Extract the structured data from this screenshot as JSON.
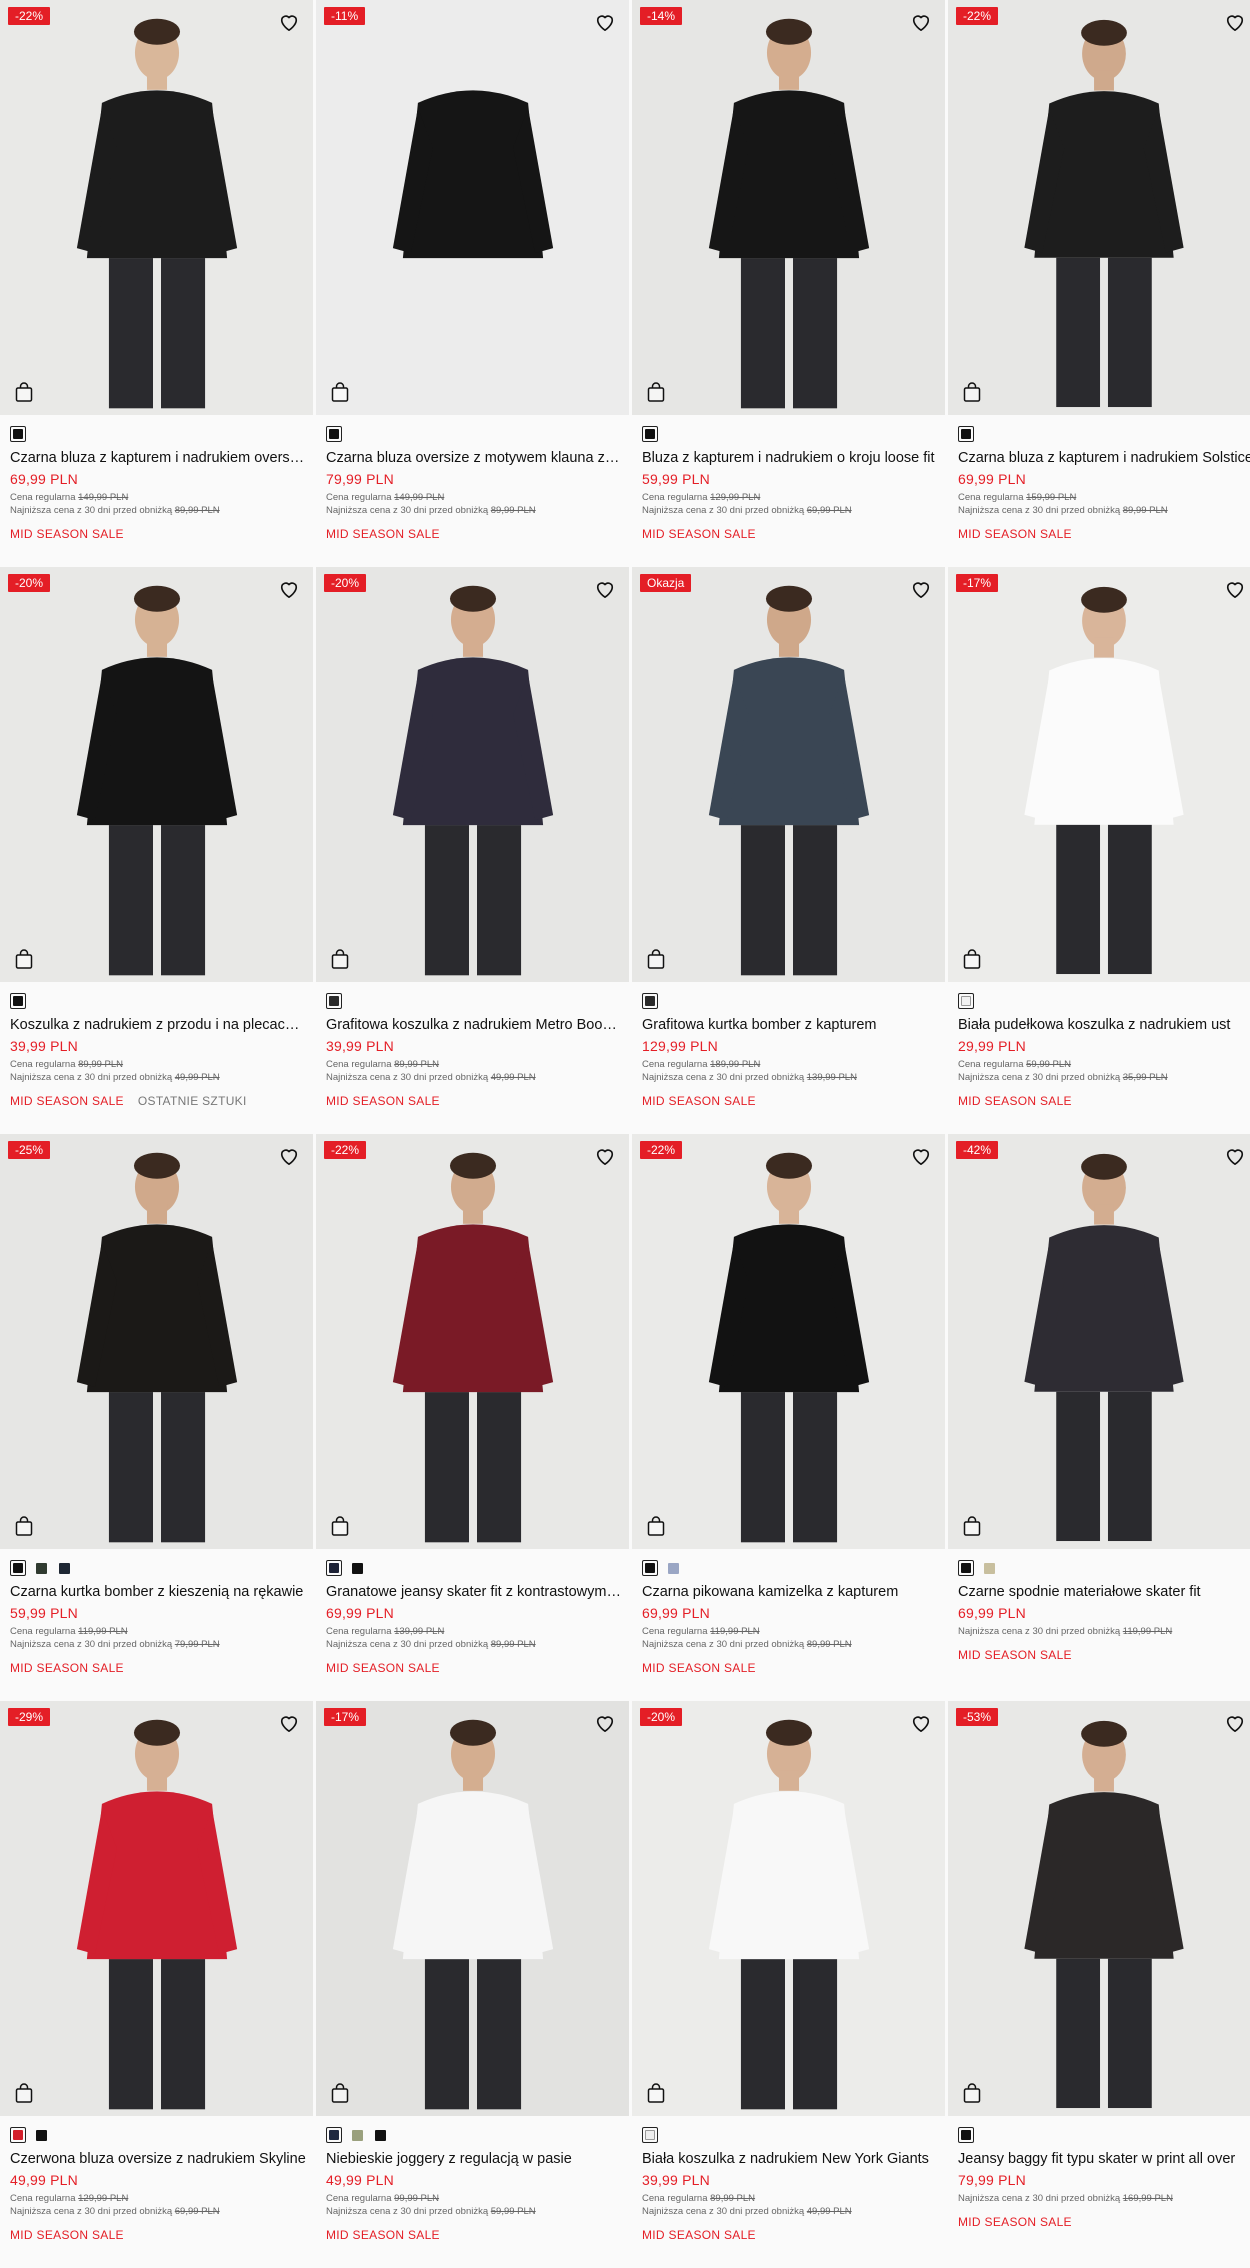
{
  "labels": {
    "regular": "Cena regularna",
    "lowest": "Najniższa cena z 30 dni przed obniżką",
    "sale": "MID SEASON SALE",
    "last": "OSTATNIE SZTUKI"
  },
  "products": [
    {
      "badge": "-22%",
      "name": "Czarna bluza z kapturem i nadrukiem oversize",
      "price": "69,99 PLN",
      "regular": "149,99 PLN",
      "lowest": "89,99 PLN",
      "swatches": [
        "#111111"
      ],
      "bg": "#e9e9e7",
      "cloth": "#1c1c1c",
      "skin": "#d9b79a",
      "tags": [
        "sale"
      ]
    },
    {
      "badge": "-11%",
      "name": "Czarna bluza oversize z motywem klauna z d…",
      "price": "79,99 PLN",
      "regular": "149,99 PLN",
      "lowest": "89,99 PLN",
      "swatches": [
        "#111111"
      ],
      "bg": "#ececec",
      "cloth": "#151515",
      "skin": "none",
      "tags": [
        "sale"
      ]
    },
    {
      "badge": "-14%",
      "name": "Bluza z kapturem i nadrukiem o kroju loose fit",
      "price": "59,99 PLN",
      "regular": "129,99 PLN",
      "lowest": "69,99 PLN",
      "swatches": [
        "#111111"
      ],
      "bg": "#e6e6e4",
      "cloth": "#161616",
      "skin": "#d4ad8f",
      "tags": [
        "sale"
      ]
    },
    {
      "badge": "-22%",
      "name": "Czarna bluza z kapturem i nadrukiem Solstice",
      "price": "69,99 PLN",
      "regular": "159,99 PLN",
      "lowest": "89,99 PLN",
      "swatches": [
        "#111111"
      ],
      "bg": "#e7e7e5",
      "cloth": "#1d1d1d",
      "skin": "#cfa98c",
      "tags": [
        "sale"
      ]
    },
    {
      "badge": "-20%",
      "name": "Koszulka z nadrukiem z przodu i na plecach …",
      "price": "39,99 PLN",
      "regular": "89,99 PLN",
      "lowest": "49,99 PLN",
      "swatches": [
        "#111111"
      ],
      "bg": "#e8e8e6",
      "cloth": "#141414",
      "skin": "#d6b294",
      "tags": [
        "sale",
        "last"
      ]
    },
    {
      "badge": "-20%",
      "name": "Grafitowa koszulka z nadrukiem Metro Boo…",
      "price": "39,99 PLN",
      "regular": "89,99 PLN",
      "lowest": "49,99 PLN",
      "swatches": [
        "#2a2a2a"
      ],
      "bg": "#e6e6e4",
      "cloth": "#2f2c3c",
      "skin": "#d4ad90",
      "tags": [
        "sale"
      ]
    },
    {
      "badge": "Okazja",
      "name": "Grafitowa kurtka bomber z kapturem",
      "price": "129,99 PLN",
      "regular": "189,99 PLN",
      "lowest": "139,99 PLN",
      "swatches": [
        "#2b2b2b"
      ],
      "bg": "#e7e7e5",
      "cloth": "#3a4654",
      "skin": "#cfa88a",
      "tags": [
        "sale"
      ]
    },
    {
      "badge": "-17%",
      "name": "Biała pudełkowa koszulka z nadrukiem ust",
      "price": "29,99 PLN",
      "regular": "59,99 PLN",
      "lowest": "35,99 PLN",
      "swatches": [
        "#f2f2f2"
      ],
      "bg": "#ececea",
      "cloth": "#fbfbfb",
      "skin": "#d9b59a",
      "tags": [
        "sale"
      ]
    },
    {
      "badge": "-25%",
      "name": "Czarna kurtka bomber z kieszenią na rękawie",
      "price": "59,99 PLN",
      "regular": "119,99 PLN",
      "lowest": "79,99 PLN",
      "swatches": [
        "#111111",
        "#2f3a2f",
        "#1e2733"
      ],
      "bg": "#e6e6e4",
      "cloth": "#1b1917",
      "skin": "#d0a98b",
      "tags": [
        "sale"
      ]
    },
    {
      "badge": "-22%",
      "name": "Granatowe jeansy skater fit z kontrastowymi…",
      "price": "69,99 PLN",
      "regular": "139,99 PLN",
      "lowest": "89,99 PLN",
      "swatches": [
        "#1d2236",
        "#111111"
      ],
      "bg": "#e8e8e6",
      "cloth": "#7a1a26",
      "skin": "#d1ab8e",
      "tags": [
        "sale"
      ]
    },
    {
      "badge": "-22%",
      "name": "Czarna pikowana kamizelka z kapturem",
      "price": "69,99 PLN",
      "regular": "119,99 PLN",
      "lowest": "89,99 PLN",
      "swatches": [
        "#111111",
        "#9aa6c4"
      ],
      "bg": "#eaeae8",
      "cloth": "#121212",
      "skin": "#d8b498",
      "tags": [
        "sale"
      ]
    },
    {
      "badge": "-42%",
      "name": "Czarne spodnie materiałowe skater fit",
      "price": "69,99 PLN",
      "regular": "",
      "lowest": "119,99 PLN",
      "swatches": [
        "#111111",
        "#c8bf9e"
      ],
      "bg": "#e8e8e6",
      "cloth": "#2e2c33",
      "skin": "#d3ad90",
      "tags": [
        "sale"
      ]
    },
    {
      "badge": "-29%",
      "name": "Czerwona bluza oversize z nadrukiem Skyline",
      "price": "49,99 PLN",
      "regular": "129,99 PLN",
      "lowest": "69,99 PLN",
      "swatches": [
        "#d31f2b",
        "#111111"
      ],
      "bg": "#e7e7e5",
      "cloth": "#cf1f31",
      "skin": "#d6b094",
      "tags": [
        "sale"
      ]
    },
    {
      "badge": "-17%",
      "name": "Niebieskie joggery z regulacją w pasie",
      "price": "49,99 PLN",
      "regular": "99,99 PLN",
      "lowest": "59,99 PLN",
      "swatches": [
        "#1f2840",
        "#9aa07d",
        "#111111"
      ],
      "bg": "#e2e2e0",
      "cloth": "#f6f6f6",
      "skin": "#d4ae90",
      "tags": [
        "sale"
      ]
    },
    {
      "badge": "-20%",
      "name": "Biała koszulka z nadrukiem New York Giants",
      "price": "39,99 PLN",
      "regular": "89,99 PLN",
      "lowest": "49,99 PLN",
      "swatches": [
        "#eeeeee"
      ],
      "bg": "#ececea",
      "cloth": "#f8f8f8",
      "skin": "#d6b195",
      "tags": [
        "sale"
      ]
    },
    {
      "badge": "-53%",
      "name": "Jeansy baggy fit typu skater w print all over",
      "price": "79,99 PLN",
      "regular": "",
      "lowest": "169,99 PLN",
      "swatches": [
        "#111111"
      ],
      "bg": "#e8e8e6",
      "cloth": "#2b2828",
      "skin": "#d4ae92",
      "tags": [
        "sale"
      ]
    }
  ]
}
